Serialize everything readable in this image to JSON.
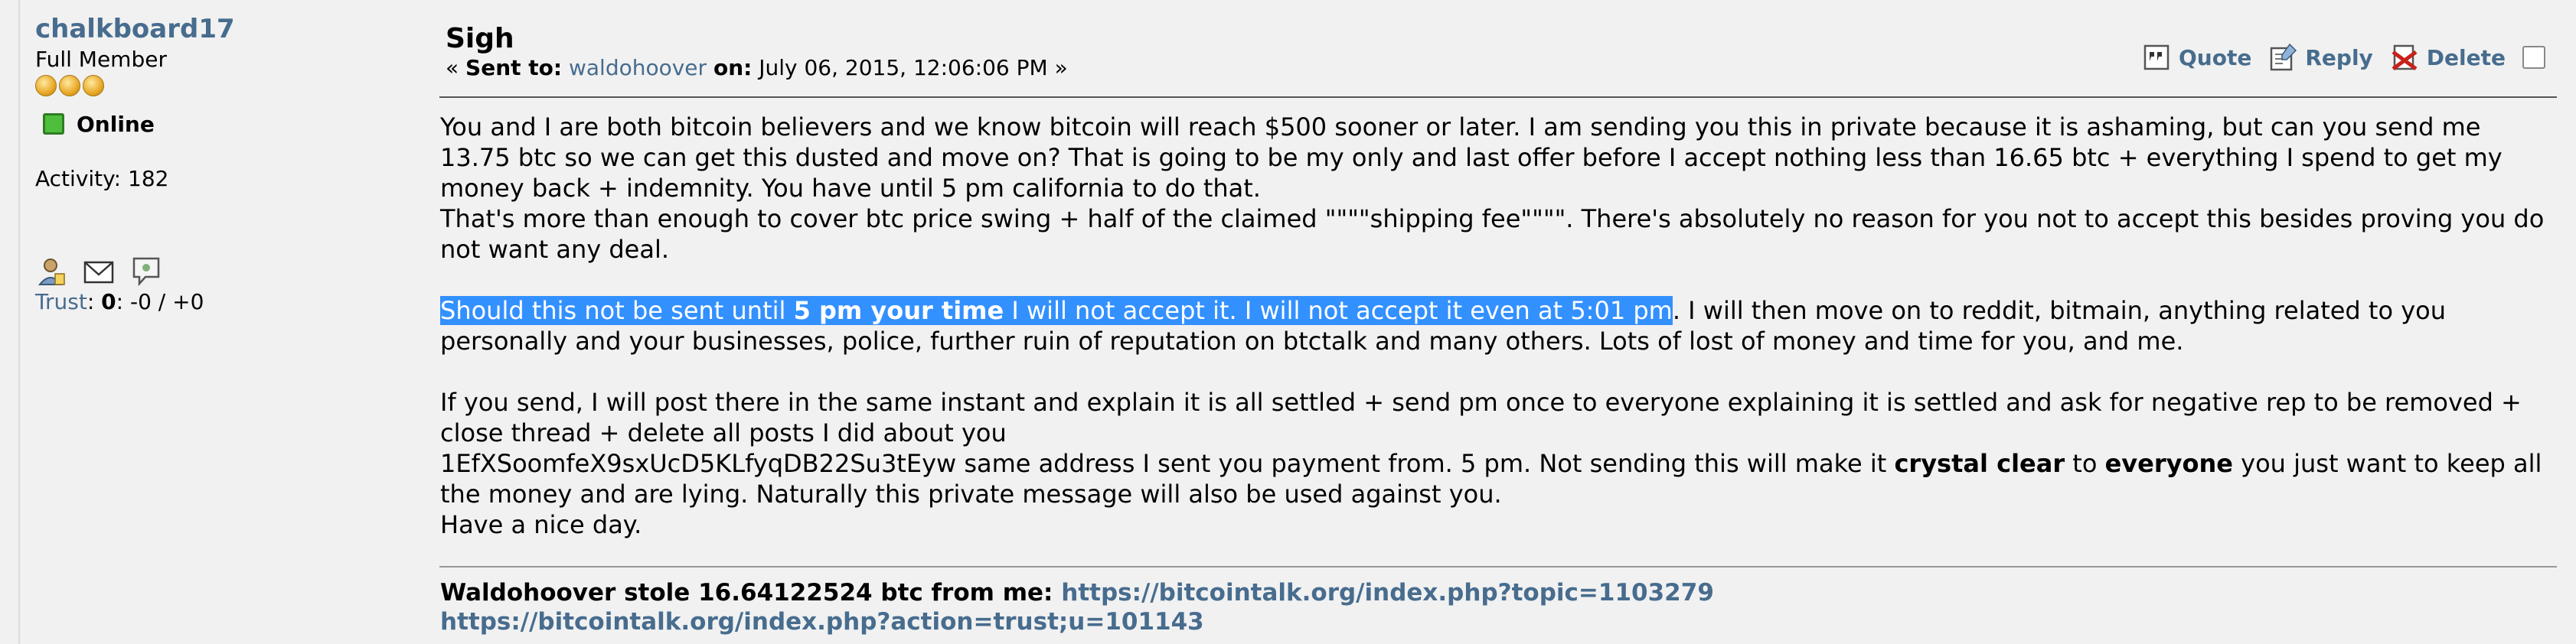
{
  "poster": {
    "name": "chalkboard17",
    "rank": "Full Member",
    "status": "Online",
    "activity": "Activity: 182",
    "trust_label": "Trust",
    "trust_value": "0",
    "trust_detail": ": -0 / +0"
  },
  "message": {
    "subject": "Sigh",
    "sent_prefix": "« ",
    "sent_label": "Sent to:",
    "recipient": "waldohoover",
    "on_label": "on:",
    "date": "July 06, 2015, 12:06:06 PM »",
    "actions": {
      "quote": "Quote",
      "reply": "Reply",
      "delete": "Delete"
    }
  },
  "body": {
    "p1": "You and I are both bitcoin believers and we know bitcoin will reach $500 sooner or later. I am sending you this in private because it is ashaming, but can you send me 13.75 btc so we can get this dusted and move on? That is going to be my only and last offer before I accept nothing less than 16.65 btc + everything I spend to get my money back + indemnity. You have until 5 pm california to do that.",
    "p2": "That's more than enough to cover btc price swing + half of the claimed \"\"\"\"shipping fee\"\"\"\". There's absolutely no reason for you not to accept this besides proving you do not want any deal.",
    "p3_a": "Should this not be sent until ",
    "p3_b": "5 pm your time",
    "p3_c": " I will not accept it. I will not accept it even at 5:01 pm",
    "p3_d": ". I will then move on to reddit, bitmain, anything related to you personally and your businesses, police, further ruin of reputation on btctalk and many others. Lots of lost of money and time for you, and me.",
    "p4": "If you send, I will post there in the same instant and explain it is all settled + send pm once to everyone explaining it is settled and ask for negative rep to be removed + close thread + delete all posts I did about you",
    "p5_a": "1EfXSoomfeX9sxUcD5KLfyqDB22Su3tEyw same address I sent you payment from. 5 pm. Not sending this will make it ",
    "p5_b": "crystal clear",
    "p5_c": " to ",
    "p5_d": "everyone",
    "p5_e": " you just want to keep all the money and are lying. Naturally this private message will also be used against you.",
    "p6": "Have a nice day."
  },
  "signature": {
    "text": "Waldohoover stole 16.64122524 btc from me: ",
    "link1": "https://bitcointalk.org/index.php?topic=1103279",
    "link2": "https://bitcointalk.org/index.php?action=trust;u=101143"
  }
}
